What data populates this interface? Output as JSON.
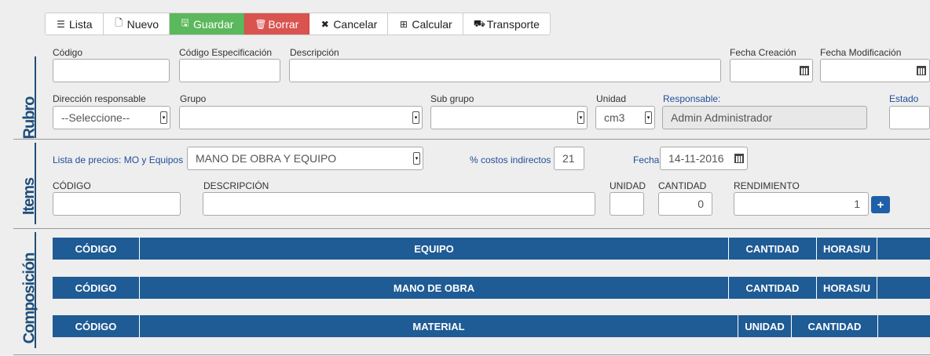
{
  "toolbar": {
    "lista": "Lista",
    "nuevo": "Nuevo",
    "guardar": "Guardar",
    "borrar": "Borrar",
    "cancelar": "Cancelar",
    "calcular": "Calcular",
    "transporte": "Transporte",
    "colors": {
      "guardar": "#5cb85c",
      "borrar": "#d9534f"
    }
  },
  "sections": {
    "rubro": "Rubro",
    "items": "Items",
    "composicion": "Composición"
  },
  "rubro": {
    "codigo_label": "Código",
    "codigo_esp_label": "Código Especificación",
    "descripcion_label": "Descripción",
    "fecha_creacion_label": "Fecha Creación",
    "fecha_modificacion_label": "Fecha Modificación",
    "direccion_label": "Dirección responsable",
    "direccion_value": "--Seleccione--",
    "grupo_label": "Grupo",
    "subgrupo_label": "Sub grupo",
    "unidad_label": "Unidad",
    "unidad_value": "cm3",
    "responsable_label": "Responsable:",
    "responsable_value": "Admin Administrador",
    "estado_label": "Estado"
  },
  "items": {
    "lista_precios_label": "Lista de precios: MO y Equipos",
    "lista_precios_value": "MANO DE OBRA Y EQUIPO",
    "costos_label": "% costos indirectos",
    "costos_value": "21",
    "fecha_label": "Fecha",
    "fecha_value": "14-11-2016",
    "codigo_label": "CÓDIGO",
    "descripcion_label": "DESCRIPCIÓN",
    "unidad_label": "UNIDAD",
    "cantidad_label": "CANTIDAD",
    "cantidad_value": "0",
    "rendimiento_label": "RENDIMIENTO",
    "rendimiento_value": "1",
    "add_label": "+"
  },
  "composicion": {
    "equipo": [
      "CÓDIGO",
      "EQUIPO",
      "CANTIDAD",
      "HORAS/U"
    ],
    "mano_obra": [
      "CÓDIGO",
      "MANO DE OBRA",
      "CANTIDAD",
      "HORAS/U"
    ],
    "material": [
      "CÓDIGO",
      "MATERIAL",
      "UNIDAD",
      "CANTIDAD"
    ]
  },
  "colors": {
    "accent": "#1f5b95",
    "section_label": "#1f4e79"
  }
}
